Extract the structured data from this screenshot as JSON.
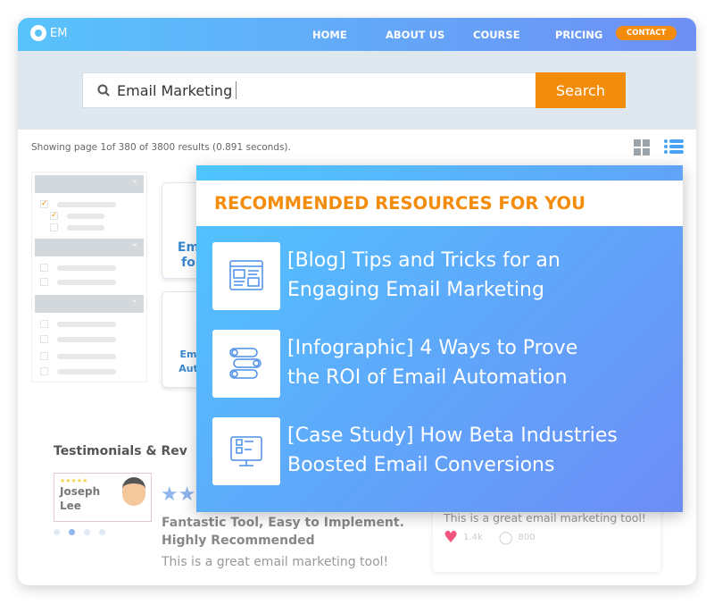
{
  "nav": {
    "logo": "EM",
    "items": [
      "HOME",
      "ABOUT US",
      "COURSE",
      "PRICING"
    ],
    "contact": "CONTACT",
    "gradient": [
      "#58c3fb",
      "#6e8ff5"
    ],
    "accent": "#f38c0b"
  },
  "search": {
    "value": "Email Marketing",
    "button": "Search"
  },
  "results": {
    "summary": "Showing page 1of 380 of 3800 results (0.891 seconds)."
  },
  "cards": [
    {
      "line1": "Em",
      "line2": "fo"
    },
    {
      "line1": "Em",
      "line2": "Aut"
    }
  ],
  "popup": {
    "title": "RECOMMENDED RESOURCES FOR YOU",
    "items": [
      {
        "line1": "[Blog] Tips and Tricks for an",
        "line2": "Engaging Email Marketing",
        "icon": "webpage-layout-icon"
      },
      {
        "line1": "[Infographic] 4 Ways to Prove",
        "line2": "the ROI of Email Automation",
        "icon": "numbered-list-icon"
      },
      {
        "line1": "[Case Study] How Beta Industries",
        "line2": "Boosted Email Conversions",
        "icon": "monitor-wireframe-icon"
      }
    ]
  },
  "testimonials": {
    "heading": "Testimonials & Rev",
    "reviewer": {
      "first": "Joseph",
      "last": "Lee",
      "stars": "★★★★★"
    },
    "stars": "★★",
    "title1": "Fantastic Tool, Easy to Implement.",
    "title2": "Highly Recommended",
    "body": "This is a great email marketing tool!",
    "side_card": {
      "body": "This is a great email marketing tool!",
      "likes": "1.4k",
      "comments": "800"
    }
  }
}
